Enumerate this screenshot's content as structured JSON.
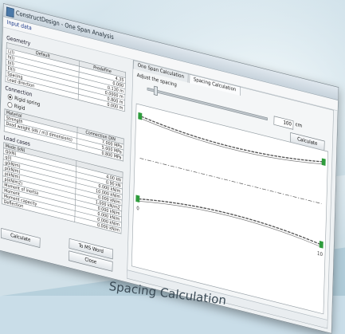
{
  "window": {
    "title": "ConstructDesign - One Span Analysis",
    "menu": "Input data"
  },
  "geometry": {
    "title": "Geometry",
    "col_default": "Default",
    "col_values": "Predefine",
    "rows": [
      {
        "label": "L(l)",
        "value": "4.35"
      },
      {
        "label": "h(l)",
        "value": "0.000"
      },
      {
        "label": "b(l)",
        "value": "0.130 m"
      },
      {
        "label": "EI(l)",
        "value": "0.0000 m"
      },
      {
        "label": "Spacing",
        "value": "0.800 m"
      },
      {
        "label": "Load direction",
        "value": "0.000 m"
      }
    ]
  },
  "connection": {
    "title": "Connection",
    "options": [
      {
        "label": "Rigid spring",
        "selected": true
      },
      {
        "label": "Rigid",
        "selected": false
      }
    ]
  },
  "material": {
    "header_left": "Material",
    "header_right": "Connection DIN",
    "rows": [
      {
        "label": "Strength",
        "value": "7.000 MPa"
      },
      {
        "label": "Dead weight (kN / m3 dimensions)",
        "value": "5.000 MPa"
      },
      {
        "label": "",
        "value": "0.800 MPa"
      }
    ]
  },
  "load": {
    "title": "Load cases",
    "subtitle": "Mode (kN)",
    "rows": [
      {
        "label": "Q(kN)",
        "value": "4.00 kN"
      },
      {
        "label": "q(l)",
        "value": "0.90 kN"
      },
      {
        "label": "g(kN/m)",
        "value": "0.000 kN/m"
      },
      {
        "label": "p(kN/m)",
        "value": "10.000 kN/m"
      },
      {
        "label": "p(kN/m)",
        "value": "0.000 kN/m"
      },
      {
        "label": "p(kN/m2)",
        "value": "1.000 kN/m2"
      },
      {
        "label": "Moment of inertia",
        "value": "0.000 kN/m"
      },
      {
        "label": "Moment",
        "value": "0.000 kN/m"
      },
      {
        "label": "Moment capacity",
        "value": "0.000 kN/m"
      },
      {
        "label": "Deflection",
        "value": "0.000 kN/m"
      }
    ]
  },
  "buttons": {
    "calculate_left": "Calculate",
    "to_ms_word": "To MS Word",
    "close": "Close",
    "calculate_right": "Calculate"
  },
  "right_panel": {
    "tabs": [
      "One Span Calculation",
      "Spacing Calculation"
    ],
    "active_tab": 1,
    "label": "Adjust the spacing",
    "slider_value": "100",
    "slider_unit": "cm",
    "support_label_left": "0",
    "support_label_right": "10"
  },
  "caption": "Spacing Calculation",
  "colors": {
    "support_green": "#2e9c3c",
    "beam_line": "#555555"
  }
}
